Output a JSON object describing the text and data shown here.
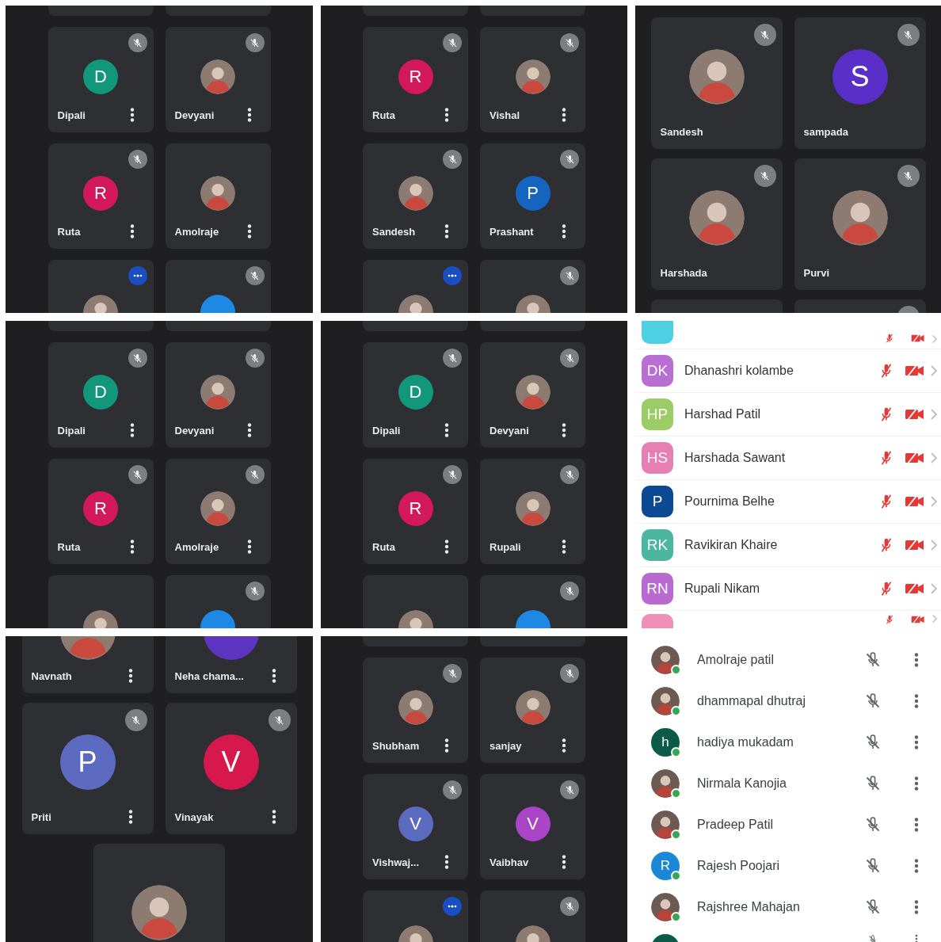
{
  "panels": [
    {
      "kind": "grid",
      "rows": [
        {
          "kind": "partial-top",
          "tiles": [
            {
              "kind": "blank",
              "menu": false
            },
            {
              "kind": "blank",
              "menu": false
            }
          ]
        },
        {
          "kind": "full",
          "tiles": [
            {
              "name": "Dipali",
              "kind": "initial",
              "initial": "D",
              "color": "#12977a",
              "muted": true,
              "speaking": false,
              "menu": true
            },
            {
              "name": "Devyani",
              "kind": "photo",
              "muted": true,
              "speaking": false,
              "menu": true
            }
          ]
        },
        {
          "kind": "full",
          "tiles": [
            {
              "name": "Ruta",
              "kind": "initial",
              "initial": "R",
              "color": "#d3185c",
              "muted": true,
              "speaking": false,
              "menu": true
            },
            {
              "name": "Amolraje",
              "kind": "photo",
              "muted": false,
              "speaking": false,
              "menu": true
            }
          ]
        },
        {
          "kind": "partial-bottom",
          "tiles": [
            {
              "kind": "photo",
              "muted": false,
              "speaking": true,
              "menu": false
            },
            {
              "kind": "initial",
              "color": "#1e88e5",
              "muted": true,
              "speaking": false,
              "menu": false
            }
          ]
        }
      ]
    },
    {
      "kind": "grid",
      "rows": [
        {
          "kind": "partial-top",
          "tiles": [
            {
              "kind": "blank",
              "menu": false
            },
            {
              "kind": "blank",
              "menu": false
            }
          ]
        },
        {
          "kind": "full",
          "tiles": [
            {
              "name": "Ruta",
              "kind": "initial",
              "initial": "R",
              "color": "#d3185c",
              "muted": true,
              "speaking": false,
              "menu": true
            },
            {
              "name": "Vishal",
              "kind": "photo",
              "muted": true,
              "speaking": false,
              "menu": true
            }
          ]
        },
        {
          "kind": "full",
          "tiles": [
            {
              "name": "Sandesh",
              "kind": "photo",
              "muted": true,
              "speaking": false,
              "menu": true
            },
            {
              "name": "Prashant",
              "kind": "initial",
              "initial": "P",
              "color": "#1565c0",
              "muted": true,
              "speaking": false,
              "menu": true
            }
          ]
        },
        {
          "kind": "partial-bottom",
          "tiles": [
            {
              "kind": "photo",
              "muted": false,
              "speaking": true,
              "menu": false
            },
            {
              "kind": "photo",
              "muted": true,
              "speaking": false,
              "menu": false
            }
          ]
        }
      ]
    },
    {
      "kind": "grid-large",
      "rows": [
        {
          "kind": "full",
          "tiles": [
            {
              "name": "Sandesh",
              "kind": "photo",
              "muted": true,
              "speaking": false,
              "menu": false
            },
            {
              "name": "sampada",
              "kind": "initial",
              "initial": "S",
              "color": "#5a2ec8",
              "muted": true,
              "speaking": false,
              "menu": false
            }
          ]
        },
        {
          "kind": "full",
          "tiles": [
            {
              "name": "Harshada",
              "kind": "photo",
              "muted": true,
              "speaking": false,
              "menu": false
            },
            {
              "name": "Purvi",
              "kind": "photo",
              "muted": true,
              "speaking": false,
              "menu": false
            }
          ]
        },
        {
          "kind": "partial-bottom",
          "tiles": [
            {
              "kind": "blank",
              "muted": false,
              "menu": false
            },
            {
              "kind": "blank",
              "muted": true,
              "menu": false
            }
          ]
        }
      ]
    },
    {
      "kind": "grid",
      "rows": [
        {
          "kind": "partial-top",
          "tiles": [
            {
              "kind": "blank",
              "menu": false
            },
            {
              "kind": "blank",
              "menu": false
            }
          ]
        },
        {
          "kind": "full",
          "tiles": [
            {
              "name": "Dipali",
              "kind": "initial",
              "initial": "D",
              "color": "#12977a",
              "muted": true,
              "speaking": false,
              "menu": true
            },
            {
              "name": "Devyani",
              "kind": "photo",
              "muted": true,
              "speaking": false,
              "menu": true
            }
          ]
        },
        {
          "kind": "full",
          "tiles": [
            {
              "name": "Ruta",
              "kind": "initial",
              "initial": "R",
              "color": "#d3185c",
              "muted": true,
              "speaking": false,
              "menu": true
            },
            {
              "name": "Amolraje",
              "kind": "photo",
              "muted": true,
              "speaking": false,
              "menu": true
            }
          ]
        },
        {
          "kind": "partial-bottom",
          "tiles": [
            {
              "kind": "photo",
              "muted": false,
              "speaking": false,
              "menu": false
            },
            {
              "kind": "initial",
              "color": "#1e88e5",
              "muted": true,
              "speaking": false,
              "menu": false
            }
          ]
        }
      ]
    },
    {
      "kind": "grid",
      "rows": [
        {
          "kind": "partial-top",
          "tiles": [
            {
              "kind": "blank",
              "menu": false
            },
            {
              "kind": "blank",
              "menu": false
            }
          ]
        },
        {
          "kind": "full",
          "tiles": [
            {
              "name": "Dipali",
              "kind": "initial",
              "initial": "D",
              "color": "#12977a",
              "muted": true,
              "speaking": false,
              "menu": true
            },
            {
              "name": "Devyani",
              "kind": "photo",
              "muted": true,
              "speaking": false,
              "menu": true
            }
          ]
        },
        {
          "kind": "full",
          "tiles": [
            {
              "name": "Ruta",
              "kind": "initial",
              "initial": "R",
              "color": "#d3185c",
              "muted": true,
              "speaking": false,
              "menu": true
            },
            {
              "name": "Rupali",
              "kind": "photo",
              "muted": true,
              "speaking": false,
              "menu": true
            }
          ]
        },
        {
          "kind": "partial-bottom",
          "tiles": [
            {
              "kind": "photo",
              "muted": false,
              "speaking": false,
              "menu": false
            },
            {
              "kind": "initial",
              "color": "#1e88e5",
              "muted": true,
              "speaking": false,
              "menu": false
            }
          ]
        }
      ]
    },
    {
      "kind": "zoom-list",
      "rows": [
        {
          "kind": "partial-top",
          "color": "#4dd0e1"
        },
        {
          "kind": "full",
          "name": "Dhanashri kolambe",
          "initials": "DK",
          "color": "#b86fd2"
        },
        {
          "kind": "full",
          "name": "Harshad Patil",
          "initials": "HP",
          "color": "#9ccc65"
        },
        {
          "kind": "full",
          "name": "Harshada Sawant",
          "initials": "HS",
          "color": "#e67fb3"
        },
        {
          "kind": "full",
          "name": "Pournima Belhe",
          "initials": "P",
          "color": "#0d4a94"
        },
        {
          "kind": "full",
          "name": "Ravikiran Khaire",
          "initials": "RK",
          "color": "#4db6a0"
        },
        {
          "kind": "full",
          "name": "Rupali Nikam",
          "initials": "RN",
          "color": "#b96ad0"
        },
        {
          "kind": "partial-bottom",
          "color": "#f090b8"
        }
      ]
    },
    {
      "kind": "grid-large",
      "rows": [
        {
          "kind": "partial-top",
          "tiles": [
            {
              "name": "Navnath",
              "kind": "photo",
              "menu": true
            },
            {
              "name": "Neha chama...",
              "kind": "initial",
              "color": "#5e35c1",
              "menu": true
            }
          ]
        },
        {
          "kind": "full",
          "tiles": [
            {
              "name": "Priti",
              "kind": "initial",
              "initial": "P",
              "color": "#5c6bc0",
              "muted": true,
              "speaking": false,
              "menu": true
            },
            {
              "name": "Vinayak",
              "kind": "initial",
              "initial": "V",
              "color": "#d6184f",
              "muted": true,
              "speaking": false,
              "menu": true
            }
          ]
        },
        {
          "kind": "partial-bottom",
          "tiles": [
            {
              "kind": "photo",
              "muted": false,
              "speaking": false,
              "menu": false
            }
          ]
        }
      ]
    },
    {
      "kind": "grid",
      "rows": [
        {
          "kind": "partial-top",
          "tiles": [
            {
              "kind": "blank",
              "menu": false
            },
            {
              "kind": "blank",
              "menu": false
            }
          ]
        },
        {
          "kind": "full",
          "tiles": [
            {
              "name": "Shubham",
              "kind": "photo",
              "muted": true,
              "speaking": false,
              "menu": true
            },
            {
              "name": "sanjay",
              "kind": "photo",
              "muted": true,
              "speaking": false,
              "menu": true
            }
          ]
        },
        {
          "kind": "full",
          "tiles": [
            {
              "name": "Vishwaj...",
              "kind": "initial",
              "initial": "V",
              "color": "#5c6bc0",
              "muted": true,
              "speaking": false,
              "menu": true
            },
            {
              "name": "Vaibhav",
              "kind": "initial",
              "initial": "V",
              "color": "#aa45c8",
              "muted": true,
              "speaking": false,
              "menu": true
            }
          ]
        },
        {
          "kind": "partial-bottom",
          "tiles": [
            {
              "kind": "photo",
              "muted": false,
              "speaking": true,
              "menu": false
            },
            {
              "kind": "photo",
              "muted": true,
              "speaking": false,
              "menu": false
            }
          ]
        }
      ]
    },
    {
      "kind": "meet-list",
      "rows": [
        {
          "kind": "photo",
          "name": "Amolraje patil"
        },
        {
          "kind": "photo",
          "name": "dhammapal dhutraj"
        },
        {
          "kind": "initial",
          "name": "hadiya mukadam",
          "initial": "h",
          "color": "#0b5b48"
        },
        {
          "kind": "photo",
          "name": "Nirmala Kanojia"
        },
        {
          "kind": "photo",
          "name": "Pradeep Patil"
        },
        {
          "kind": "initial",
          "name": "Rajesh Poojari",
          "initial": "R",
          "color": "#1a88d6"
        },
        {
          "kind": "photo",
          "name": "Rajshree Mahajan"
        },
        {
          "kind": "partial",
          "color": "#0b5b48"
        }
      ]
    }
  ]
}
